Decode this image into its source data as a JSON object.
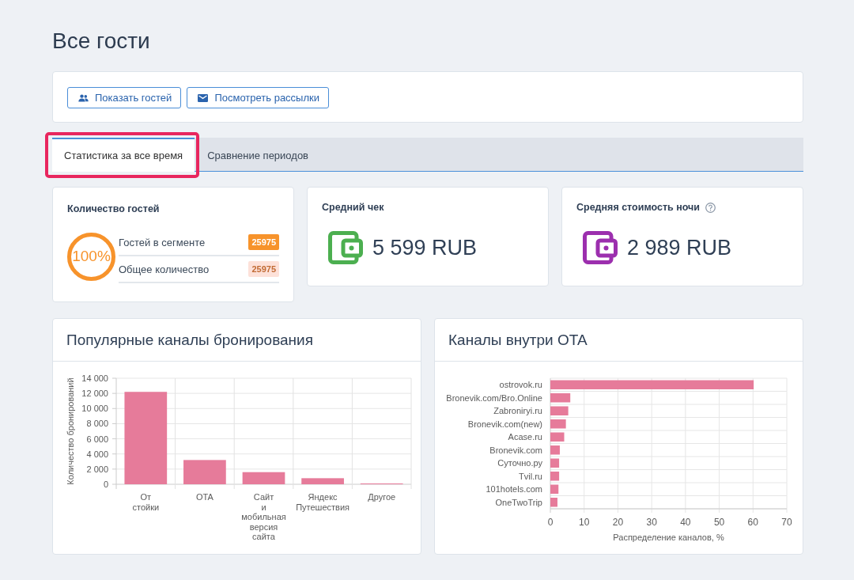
{
  "page": {
    "title": "Все гости"
  },
  "actions": [
    {
      "label": "Показать гостей"
    },
    {
      "label": "Посмотреть рассылки"
    }
  ],
  "tabs": [
    {
      "label": "Статистика за все время",
      "selected": true,
      "highlighted": true
    },
    {
      "label": "Сравнение периодов",
      "selected": false,
      "highlighted": false
    }
  ],
  "guests_card": {
    "title": "Количество гостей",
    "share": {
      "label": "100%",
      "level": 1
    },
    "rows": [
      {
        "label": "Гостей в сегменте",
        "value": "25975",
        "kind": "solid",
        "color": "#f7932b"
      },
      {
        "label": "Общее количество",
        "value": "25975",
        "kind": "soft",
        "color": "#fde1d9"
      }
    ]
  },
  "metrics": [
    {
      "title": "Средний чек",
      "value": "5 599 RUB",
      "color": "#4caf50",
      "help": false
    },
    {
      "title": "Средняя стоимость ночи",
      "value": "2 989 RUB",
      "color": "#9c2fae",
      "help": true
    }
  ],
  "panels": [
    {
      "title": "Популярные каналы бронирования",
      "chart_data": {
        "type": "bar",
        "orientation": "vertical",
        "grid": true,
        "ylabel": "Количество бронирований",
        "categories": [
          "От стойки",
          "OTA",
          "Сайт и мобильная версия сайта",
          "Яндекс Путешествия",
          "Другое"
        ],
        "values": [
          12200,
          3200,
          1600,
          800,
          100
        ],
        "ylim": [
          0,
          14000
        ],
        "yticks": [
          {
            "value": 0,
            "label": "0"
          },
          {
            "value": 2000,
            "label": "2 000"
          },
          {
            "value": 4000,
            "label": "4 000"
          },
          {
            "value": 6000,
            "label": "6 000"
          },
          {
            "value": 8000,
            "label": "8 000"
          },
          {
            "value": 10000,
            "label": "10 000"
          },
          {
            "value": 12000,
            "label": "12 000"
          },
          {
            "value": 14000,
            "label": "14 000"
          }
        ]
      }
    },
    {
      "title": "Каналы внутри OTA",
      "chart_data": {
        "type": "bar",
        "orientation": "horizontal",
        "grid": true,
        "xlabel": "Распределение каналов, %",
        "categories": [
          "ostrovok.ru",
          "Bronevik.com/Bro.Online",
          "Zabroniryi.ru",
          "Bronevik.com(new)",
          "Acase.ru",
          "Bronevik.com",
          "Суточно.ру",
          "Tvil.ru",
          "101hotels.com",
          "OneTwoTrip"
        ],
        "values": [
          60.2,
          5.9,
          5.3,
          4.6,
          4.1,
          2.8,
          2.6,
          2.6,
          2.4,
          2.1
        ],
        "xlim": [
          0,
          70
        ],
        "xticks": [
          0,
          10,
          20,
          30,
          40,
          50,
          60,
          70
        ]
      }
    }
  ]
}
